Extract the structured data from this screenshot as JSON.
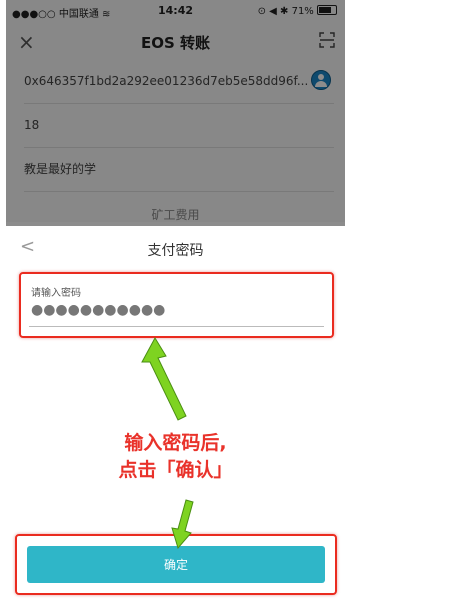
{
  "status_bar": {
    "signal": "●●●○○",
    "carrier": "中国联通",
    "wifi": "≋",
    "time": "14:42",
    "right_icons": "⊙ ◀ ✱",
    "battery": "71%"
  },
  "header": {
    "close_icon": "close-icon",
    "title": "EOS 转账",
    "scan_icon": "scan-icon"
  },
  "form": {
    "address": "0x646357f1bd2a292ee01236d7eb5e58dd96f...",
    "amount": "18",
    "memo": "教是最好的学",
    "fee_label": "矿工费用"
  },
  "sheet": {
    "back_glyph": "<",
    "title": "支付密码",
    "password_label": "请输入密码",
    "password_value": "●●●●●●●●●●●",
    "confirm_label": "确定"
  },
  "annotation": {
    "line1": "输入密码后,",
    "line2": "点击「确认」"
  },
  "colors": {
    "accent": "#2fb6c8",
    "highlight": "#ea2b1f",
    "arrow": "#7ed321"
  }
}
